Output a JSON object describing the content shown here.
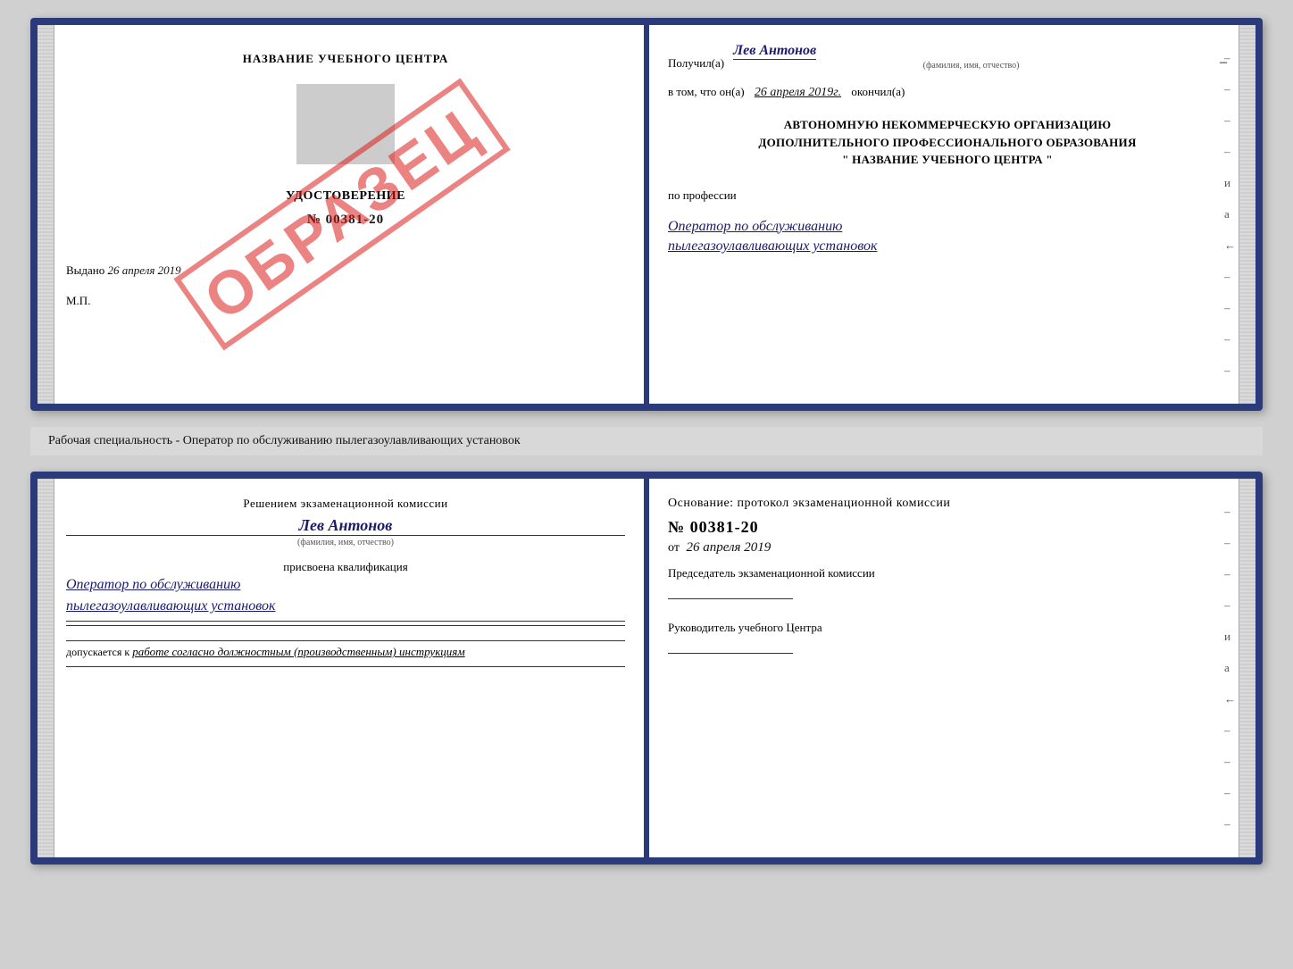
{
  "top_book": {
    "left": {
      "org_title": "НАЗВАНИЕ УЧЕБНОГО ЦЕНТРА",
      "cert_label": "УДОСТОВЕРЕНИЕ",
      "cert_number": "№ 00381-20",
      "issued_label": "Выдано",
      "issued_date": "26 апреля 2019",
      "mp_label": "М.П.",
      "obrazets": "ОБРАЗЕЦ"
    },
    "right": {
      "received_prefix": "Получил(а)",
      "recipient_name": "Лев Антонов",
      "fio_hint": "(фамилия, имя, отчество)",
      "in_that_prefix": "в том, что он(а)",
      "completed_date": "26 апреля 2019г.",
      "completed_label": "окончил(а)",
      "org_line1": "АВТОНОМНУЮ НЕКОММЕРЧЕСКУЮ ОРГАНИЗАЦИЮ",
      "org_line2": "ДОПОЛНИТЕЛЬНОГО ПРОФЕССИОНАЛЬНОГО ОБРАЗОВАНИЯ",
      "org_line3": "\" НАЗВАНИЕ УЧЕБНОГО ЦЕНТРА \"",
      "profession_label": "по профессии",
      "profession_line1": "Оператор по обслуживанию",
      "profession_line2": "пылегазоулавливающих установок",
      "dashes": [
        "-",
        "-",
        "-",
        "-",
        "и",
        "а",
        "←",
        "-",
        "-",
        "-",
        "-"
      ]
    }
  },
  "middle_strip": {
    "text": "Рабочая специальность - Оператор по обслуживанию пылегазоулавливающих установок"
  },
  "bottom_book": {
    "left": {
      "commission_line": "Решением экзаменационной комиссии",
      "person_name": "Лев Антонов",
      "fio_hint": "(фамилия, имя, отчество)",
      "qualification_label": "присвоена квалификация",
      "qualification_line1": "Оператор по обслуживанию",
      "qualification_line2": "пылегазоулавливающих установок",
      "допускается_label": "допускается к",
      "допускается_value": "работе согласно должностным (производственным) инструкциям"
    },
    "right": {
      "basis_label": "Основание: протокол экзаменационной комиссии",
      "protocol_number": "№ 00381-20",
      "date_prefix": "от",
      "protocol_date": "26 апреля 2019",
      "chairman_label": "Председатель экзаменационной комиссии",
      "head_label": "Руководитель учебного Центра",
      "dashes": [
        "-",
        "-",
        "-",
        "-",
        "и",
        "а",
        "←",
        "-",
        "-",
        "-",
        "-"
      ]
    }
  }
}
